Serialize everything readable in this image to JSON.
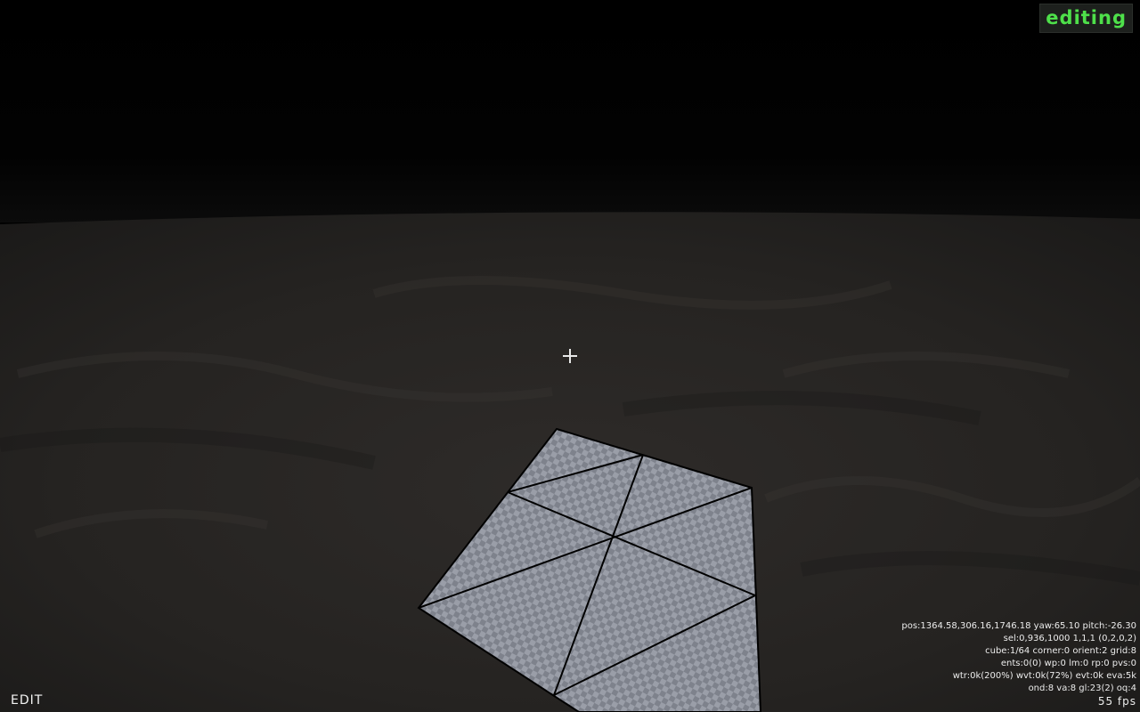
{
  "mode_badge": "editing",
  "mode_label": "EDIT",
  "stats": {
    "pos": "pos:1364.58,306.16,1746.18 yaw:65.10 pitch:-26.30",
    "sel": "sel:0,936,1000 1,1,1 (0,2,0,2)",
    "cube": "cube:1/64 corner:0 orient:2 grid:8",
    "ents": "ents:0(0) wp:0 lm:0 rp:0 pvs:0",
    "wtr": "wtr:0k(200%) wvt:0k(72%) evt:0k eva:5k",
    "ond": "ond:8 va:8 gl:23(2) oq:4",
    "fps": "55 fps"
  },
  "colors": {
    "badge_text": "#4ee04a",
    "hud_text": "#ececec",
    "terrain": "#2b2826",
    "surface": "#8a8e98"
  },
  "icons": {
    "crosshair": "crosshair-icon"
  }
}
